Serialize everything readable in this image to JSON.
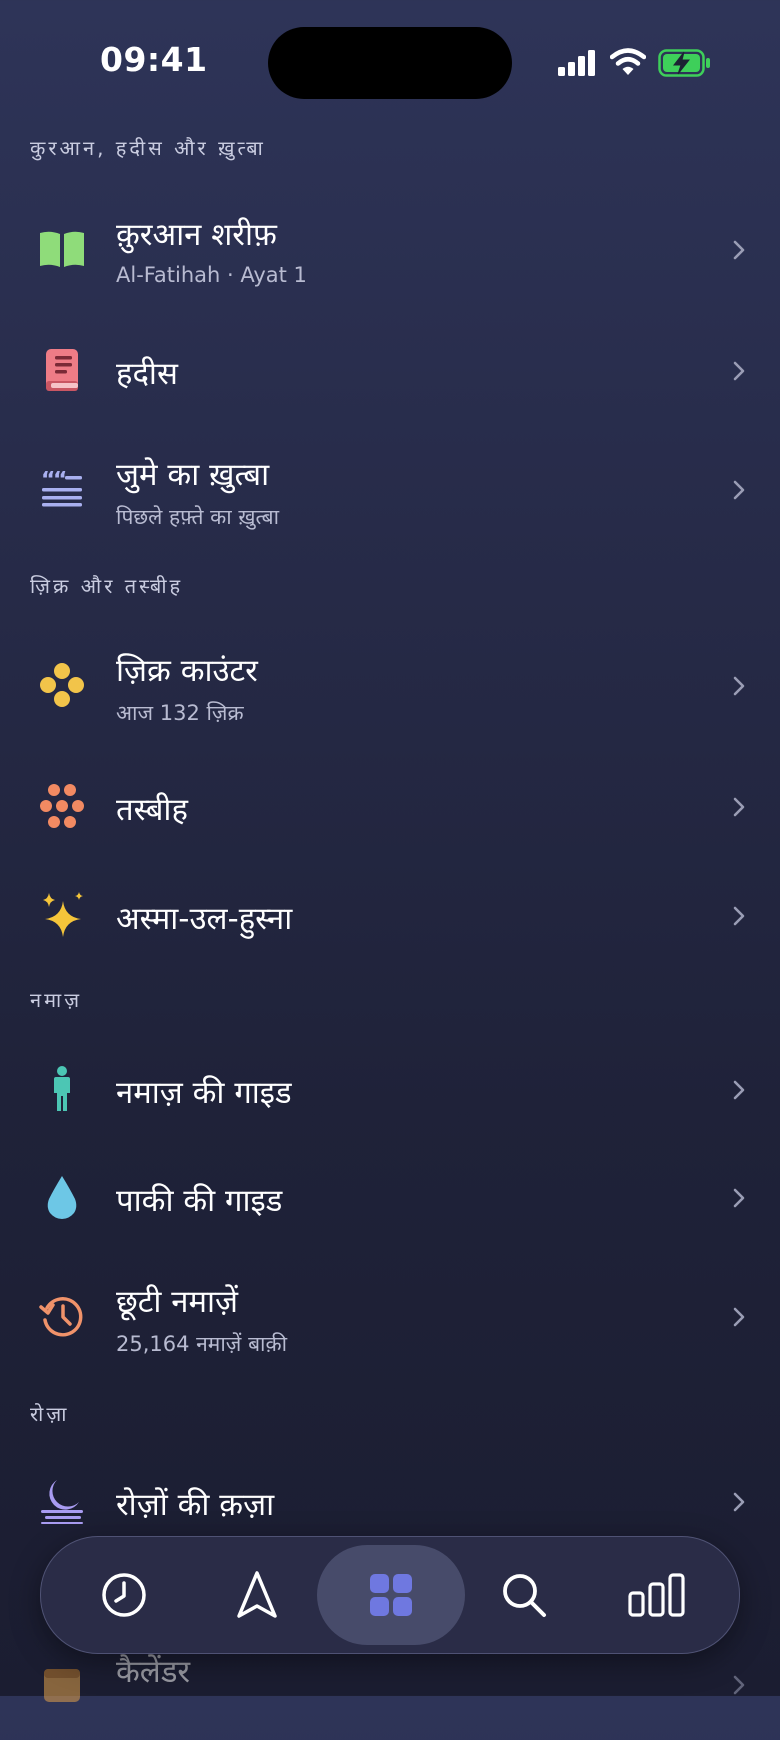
{
  "status": {
    "time": "09:41"
  },
  "sections": {
    "quran": {
      "header": "कुरआन, हदीस और ख़ुत्बा",
      "items": [
        {
          "title": "क़ुरआन शरीफ़",
          "subtitle": "Al-Fatihah · Ayat 1",
          "icon": "open-book-icon",
          "color": "#8fdc7a"
        },
        {
          "title": "हदीस",
          "icon": "book-icon",
          "color": "#ee7c86"
        },
        {
          "title": "जुमे का ख़ुत्बा",
          "subtitle": "पिछले हफ़्ते का ख़ुत्बा",
          "icon": "quote-lines-icon",
          "color": "#a9b0f0"
        }
      ]
    },
    "zikr": {
      "header": "ज़िक्र और तस्बीह",
      "items": [
        {
          "title": "ज़िक्र काउंटर",
          "subtitle": "आज 132 ज़िक्र",
          "icon": "dots-cluster-icon",
          "color": "#f2c44a"
        },
        {
          "title": "तस्बीह",
          "icon": "beads-icon",
          "color": "#f28a62"
        },
        {
          "title": "अस्मा-उल-हुस्ना",
          "icon": "sparkles-icon",
          "color": "#f5c53a"
        }
      ]
    },
    "namaz": {
      "header": "नमाज़",
      "items": [
        {
          "title": "नमाज़ की गाइड",
          "icon": "person-icon",
          "color": "#4cc6b4"
        },
        {
          "title": "पाकी की गाइड",
          "icon": "drop-icon",
          "color": "#6dc7e6"
        },
        {
          "title": "छूटी नमाज़ें",
          "subtitle": "25,164 नमाज़ें बाक़ी",
          "icon": "history-icon",
          "color": "#f0926a"
        }
      ]
    },
    "roza": {
      "header": "रोज़ा",
      "items": [
        {
          "title": "रोज़ों की क़ज़ा",
          "icon": "moon-icon",
          "color": "#a99cf2"
        }
      ]
    },
    "other": {
      "items": [
        {
          "title": "कैलेंडर",
          "icon": "calendar-icon",
          "color": "#e0a04a"
        }
      ]
    }
  },
  "tabs": [
    "clock-icon",
    "compass-arrow-icon",
    "grid-icon",
    "search-icon",
    "stats-icon"
  ],
  "colors": {
    "accent": "#6f78e0",
    "chevron": "#9a9db5"
  }
}
